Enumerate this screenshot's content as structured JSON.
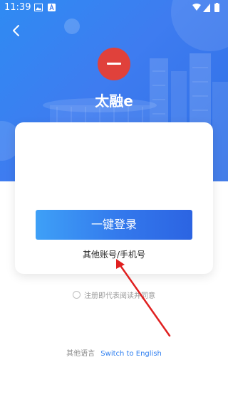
{
  "status_bar": {
    "time": "11:39"
  },
  "app": {
    "name": "太融e"
  },
  "card": {
    "login_button_label": "一键登录",
    "other_account_label": "其他账号/手机号"
  },
  "agreement": {
    "text": "注册即代表阅读并同意"
  },
  "language": {
    "label": "其他语言",
    "link": "Switch to English"
  },
  "colors": {
    "primary": "#2f7ff0",
    "logo": "#e0413b",
    "annotation_arrow": "#e02020"
  }
}
